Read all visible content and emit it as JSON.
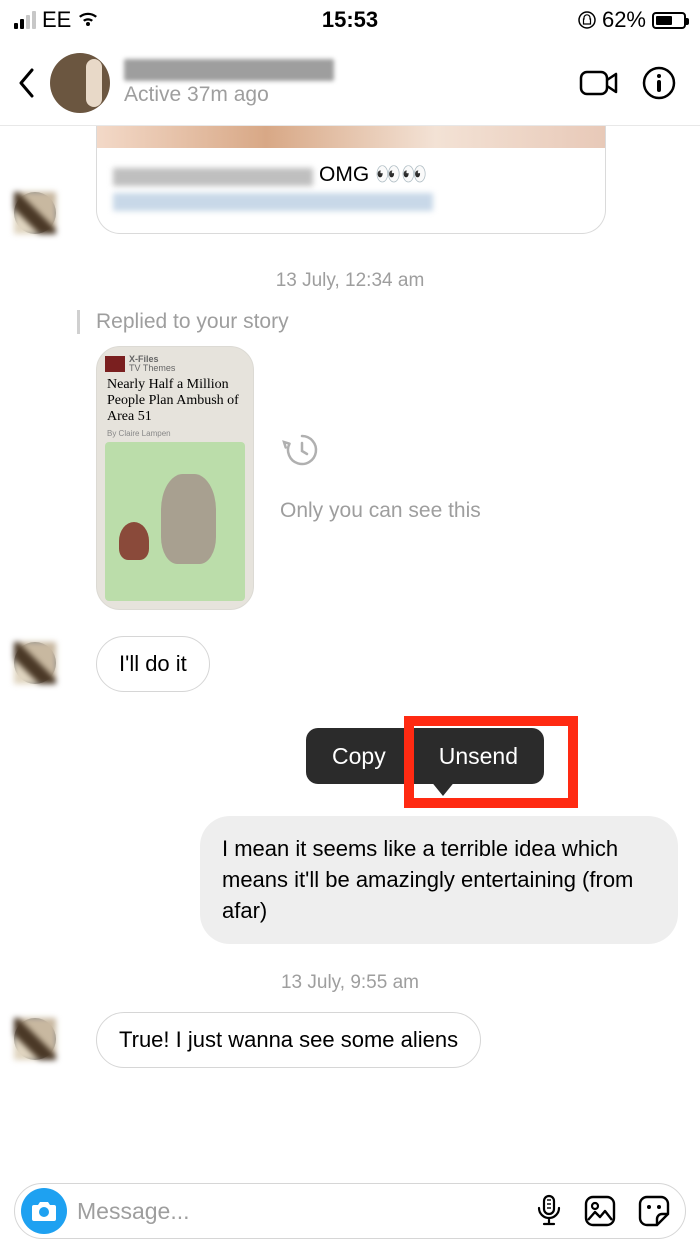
{
  "status": {
    "carrier": "EE",
    "time": "15:53",
    "battery_pct": "62%",
    "battery_fill_pct": 62
  },
  "header": {
    "active": "Active 37m ago"
  },
  "card1": {
    "caption": "OMG 👀👀"
  },
  "ts1": "13 July, 12:34 am",
  "reply": {
    "label": "Replied to your story",
    "headline_top": "X-Files",
    "headline_sub": "TV Themes",
    "headline": "Nearly Half a Million People Plan Ambush of Area 51",
    "byline": "By Claire Lampen",
    "hint": "Only you can see this",
    "msg": "I'll do it"
  },
  "ts2_partial": "13 J",
  "ctx": {
    "copy": "Copy",
    "unsend": "Unsend"
  },
  "out_msg": "I mean it seems like a terrible idea which means it'll be amazingly entertaining (from afar)",
  "ts3": "13 July, 9:55 am",
  "in_msg2": "True! I just wanna see some aliens",
  "composer": {
    "placeholder": "Message..."
  }
}
